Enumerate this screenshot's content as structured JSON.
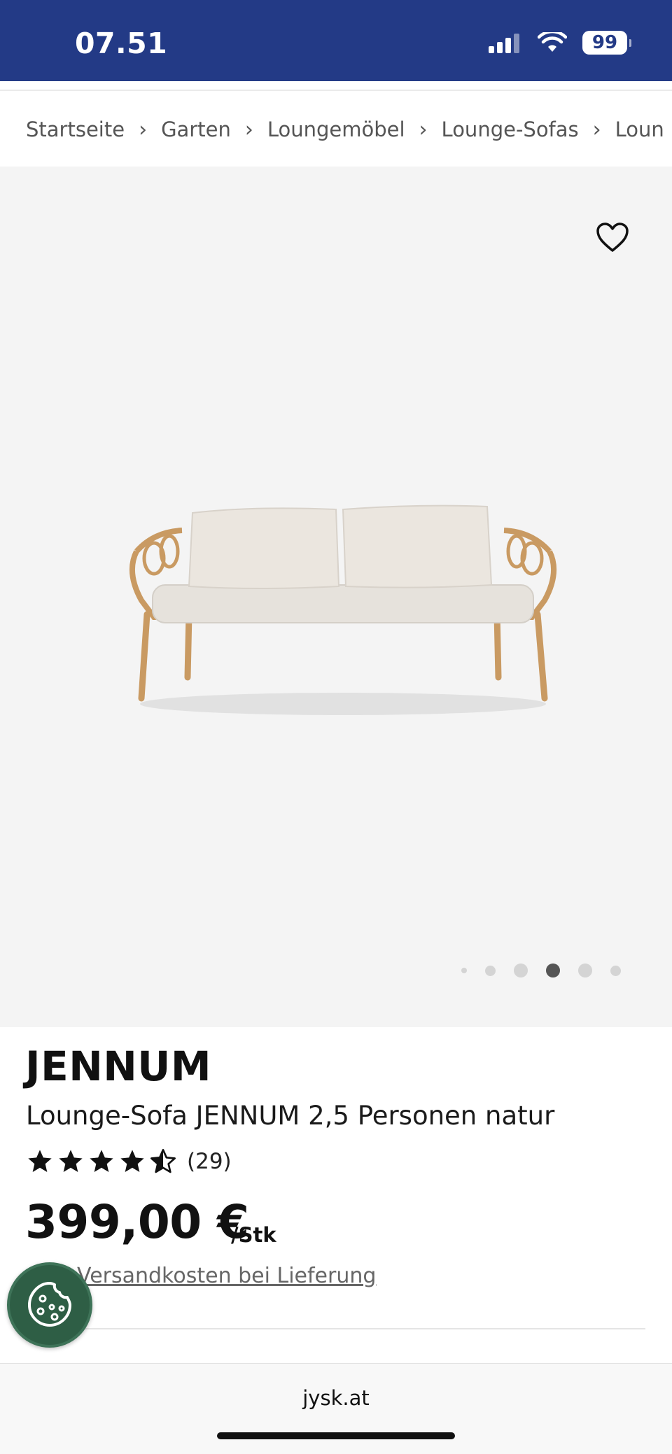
{
  "status_bar": {
    "time": "07.51",
    "battery": "99"
  },
  "breadcrumb": [
    "Startseite",
    "Garten",
    "Loungemöbel",
    "Lounge-Sofas",
    "Loun"
  ],
  "gallery": {
    "image_count": 6,
    "active_index": 3
  },
  "product": {
    "brand": "JENNUM",
    "name": "Lounge-Sofa JENNUM 2,5 Personen natur",
    "rating": 4.5,
    "rating_count": "(29)",
    "price": "399,00 €",
    "unit": "/Stk",
    "shipping_link": "Versandkosten bei Lieferung"
  },
  "browser": {
    "url": "jysk.at"
  },
  "colors": {
    "header": "#233a86",
    "cookie_button": "#2e5e45"
  }
}
